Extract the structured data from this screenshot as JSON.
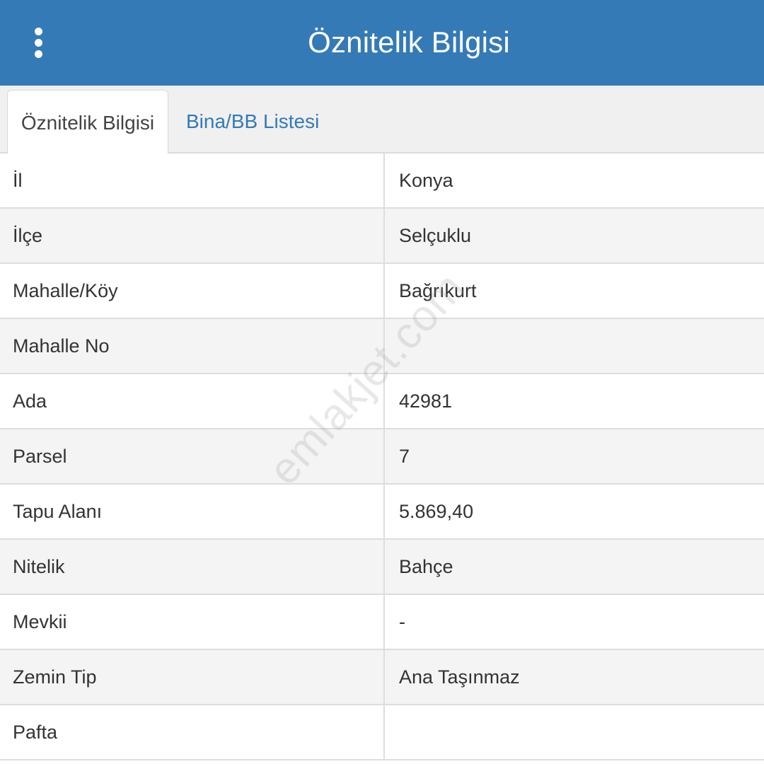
{
  "header": {
    "title": "Öznitelik Bilgisi",
    "menu_icon": "vertical-dots-icon"
  },
  "tabs": [
    {
      "label": "Öznitelik Bilgisi",
      "active": true
    },
    {
      "label": "Bina/BB Listesi",
      "active": false
    }
  ],
  "attributes": [
    {
      "label": "İl",
      "value": "Konya"
    },
    {
      "label": "İlçe",
      "value": "Selçuklu"
    },
    {
      "label": "Mahalle/Köy",
      "value": "Bağrıkurt"
    },
    {
      "label": "Mahalle No",
      "value": ""
    },
    {
      "label": "Ada",
      "value": "42981"
    },
    {
      "label": "Parsel",
      "value": "7"
    },
    {
      "label": "Tapu Alanı",
      "value": "5.869,40"
    },
    {
      "label": "Nitelik",
      "value": "Bahçe"
    },
    {
      "label": "Mevkii",
      "value": "-"
    },
    {
      "label": "Zemin Tip",
      "value": "Ana Taşınmaz"
    },
    {
      "label": "Pafta",
      "value": ""
    }
  ],
  "watermark": "emlakjet.com",
  "colors": {
    "header_bg": "#347ab7",
    "link": "#337ab7"
  }
}
